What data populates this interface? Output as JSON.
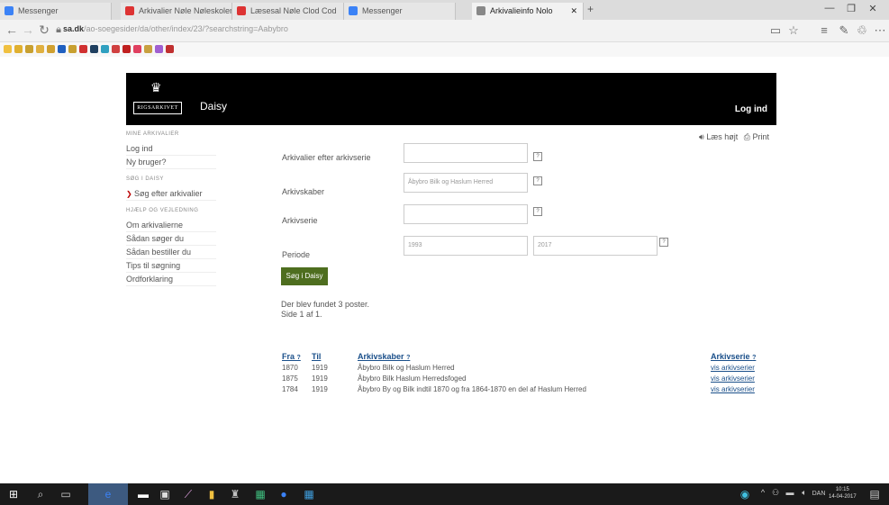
{
  "browser": {
    "tabs": [
      {
        "label": "Messenger",
        "color": "#3b82f6"
      },
      {
        "label": "Arkivalier Nøle Nøleskolen Clod",
        "color": "#d33"
      },
      {
        "label": "Læsesal Nøle Clod Cod",
        "color": "#d33"
      },
      {
        "label": "Messenger",
        "color": "#3b82f6"
      },
      {
        "label": "Arkivalieinfo Nolo",
        "color": "#888"
      }
    ],
    "new_tab": "+",
    "url_domain": "sa.dk",
    "url_rest": "/ao-soegesider/da/other/index/23/?searchstring=Aabybro",
    "window_controls": [
      "—",
      "❐",
      "✕"
    ]
  },
  "site": {
    "logo_text": "RIGSARKIVET",
    "name": "Daisy",
    "login": "Log ind"
  },
  "sidebar": {
    "section1": "MINE ARKIVALIER",
    "items1": [
      "Log ind",
      "Ny bruger?"
    ],
    "section2": "SØG I DAISY",
    "items2": [
      "Søg efter arkivalier"
    ],
    "section3": "HJÆLP OG VEJLEDNING",
    "items3": [
      "Om arkivalierne",
      "Sådan søger du",
      "Sådan bestiller du",
      "Tips til søgning",
      "Ordforklaring"
    ]
  },
  "util": {
    "lens": "Læs højt",
    "print": "Print"
  },
  "form": {
    "label_arkivnr": "Arkivalier efter arkivserie",
    "label_arkivskaber": "Arkivskaber",
    "value_arkivskaber": "Åbybro Bilk og Haslum Herred",
    "label_arkivserie": "Arkivserie",
    "label_periode": "Periode",
    "period_from": "1993",
    "period_to": "2017",
    "search_button": "Søg i Daisy"
  },
  "results": {
    "line1": "Der blev fundet 3 poster.",
    "line2": "Side 1 af 1."
  },
  "table": {
    "headers": {
      "fra": "Fra",
      "til": "Til",
      "arkivskaber": "Arkivskaber",
      "arkivserie": "Arkivserie"
    },
    "rows": [
      {
        "fra": "1870",
        "til": "1919",
        "arkivskaber": "Åbybro Bilk og Haslum Herred",
        "link": "vis arkivserier"
      },
      {
        "fra": "1875",
        "til": "1919",
        "arkivskaber": "Åbybro Bilk Haslum Herredsfoged",
        "link": "vis arkivserier"
      },
      {
        "fra": "1784",
        "til": "1919",
        "arkivskaber": "Åbybro By og Bilk indtil 1870 og fra 1864-1870 en del af Haslum Herred",
        "link": "vis arkivserier"
      }
    ]
  },
  "taskbar": {
    "time": "10:15",
    "date": "14-04-2017",
    "lang": "DAN"
  }
}
